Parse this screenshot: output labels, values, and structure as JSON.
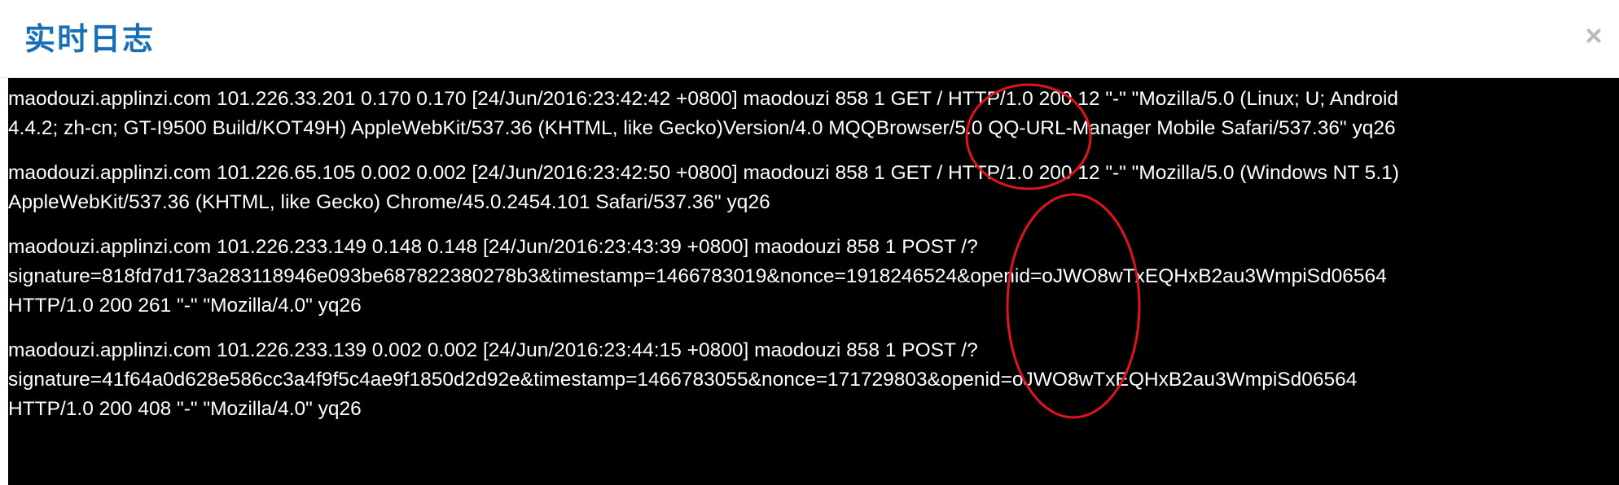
{
  "modal": {
    "title": "实时日志",
    "close_label": "×"
  },
  "logs": [
    {
      "lines": [
        "maodouzi.applinzi.com 101.226.33.201 0.170 0.170 [24/Jun/2016:23:42:42 +0800] maodouzi 858 1 GET / HTTP/1.0 200 12 \"-\" \"Mozilla/5.0 (Linux; U; Android",
        "4.4.2; zh-cn; GT-I9500 Build/KOT49H) AppleWebKit/537.36 (KHTML, like Gecko)Version/4.0 MQQBrowser/5.0 QQ-URL-Manager Mobile Safari/537.36\" yq26"
      ]
    },
    {
      "lines": [
        "maodouzi.applinzi.com 101.226.65.105 0.002 0.002 [24/Jun/2016:23:42:50 +0800] maodouzi 858 1 GET / HTTP/1.0 200 12 \"-\" \"Mozilla/5.0 (Windows NT 5.1)",
        "AppleWebKit/537.36 (KHTML, like Gecko) Chrome/45.0.2454.101 Safari/537.36\" yq26"
      ]
    },
    {
      "lines": [
        "maodouzi.applinzi.com 101.226.233.149 0.148 0.148 [24/Jun/2016:23:43:39 +0800] maodouzi 858 1 POST /?",
        "signature=818fd7d173a283118946e093be687822380278b3&timestamp=1466783019&nonce=1918246524&openid=oJWO8wTxEQHxB2au3WmpiSd06564",
        "HTTP/1.0 200 261 \"-\" \"Mozilla/4.0\" yq26"
      ]
    },
    {
      "lines": [
        "maodouzi.applinzi.com 101.226.233.139 0.002 0.002 [24/Jun/2016:23:44:15 +0800] maodouzi 858 1 POST /?",
        "signature=41f64a0d628e586cc3a4f9f5c4ae9f1850d2d92e&timestamp=1466783055&nonce=171729803&openid=oJWO8wTxEQHxB2au3WmpiSd06564",
        "HTTP/1.0 200 408 \"-\" \"Mozilla/4.0\" yq26"
      ]
    }
  ],
  "colors": {
    "title": "#1a6fb4",
    "panel_bg": "#000000",
    "log_text": "#ffffff",
    "annotation": "#e0141e"
  },
  "annotations": [
    {
      "shape": "ellipse",
      "meaning": "highlighted GET request fields"
    },
    {
      "shape": "ellipse",
      "meaning": "highlighted POST request fields"
    }
  ]
}
